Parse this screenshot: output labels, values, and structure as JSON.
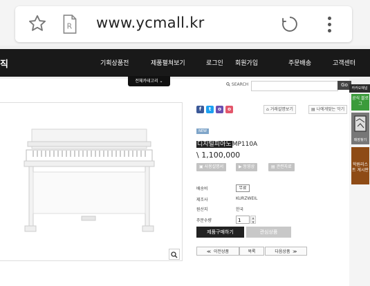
{
  "browser": {
    "url": "www.ycmall.kr",
    "icons": [
      "star-icon",
      "reader-icon",
      "reload-icon",
      "menu-icon"
    ]
  },
  "nav": {
    "logo_fragment": "직",
    "items": [
      "기획상품전",
      "제품펼쳐보기",
      "로그인",
      "회원가입",
      "주문배송",
      "고객센터"
    ],
    "category_button": "전체카테고리 ⌄"
  },
  "search": {
    "label": "SEARCH",
    "value": "",
    "go": "Go"
  },
  "product": {
    "actions": [
      "거래설명보기",
      "나에게맞는 악기"
    ],
    "badge": "NEW",
    "name_highlight": "디지털피아노",
    "name_model": "MP110A",
    "price": "\\ 1,100,000",
    "gray_buttons": [
      "사용설명서",
      "동영상",
      "관련자료"
    ],
    "info": {
      "shipping_label": "배송비",
      "shipping_value": "무료",
      "maker_label": "제조사",
      "maker_value": "KURZWEIL",
      "origin_label": "원산지",
      "origin_value": "한국",
      "qty_label": "주문수량",
      "qty_value": "1"
    },
    "buy_label": "제품구매하기",
    "wish_label": "관심상품",
    "prev_label": "이전상품",
    "list_label": "목록",
    "next_label": "다음상품"
  },
  "rightbar": {
    "header": "카카오채널",
    "green_label": "공식 블로그",
    "gray_label": "매장찾기",
    "orange_label": "학원리스트 게시판"
  },
  "colors": {
    "nav_bg": "#191919",
    "green": "#3b9b3b",
    "orange": "#8e4b15",
    "accent_badge": "#7fa5c9"
  }
}
